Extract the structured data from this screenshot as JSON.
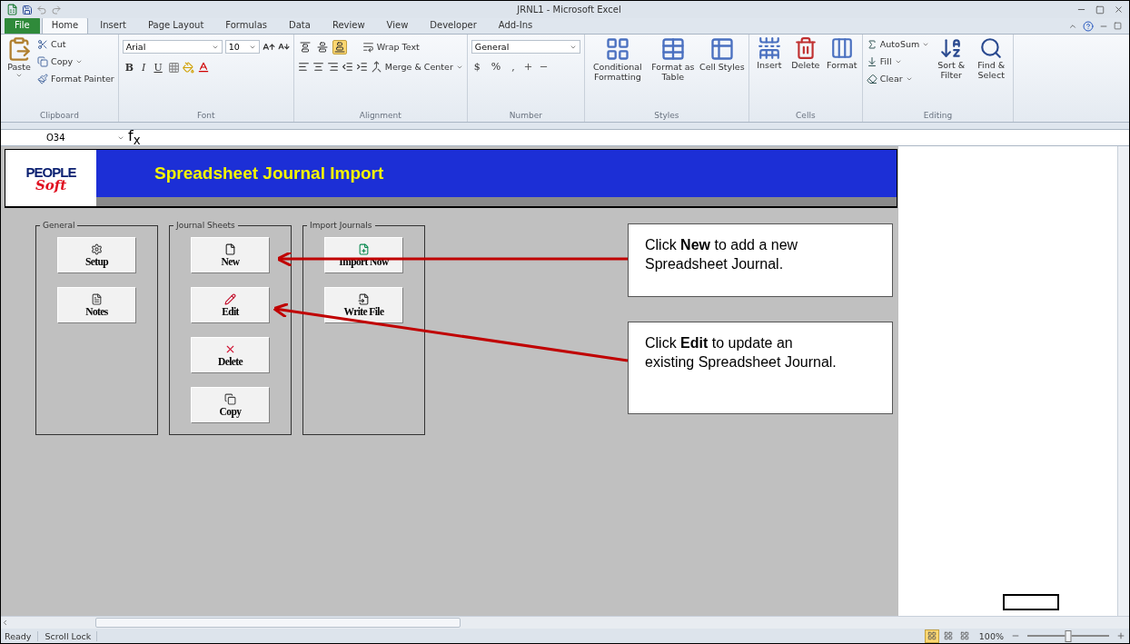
{
  "window": {
    "title": "JRNL1 - Microsoft Excel"
  },
  "tabs": [
    {
      "label": "File",
      "kind": "file",
      "selected": false
    },
    {
      "label": "Home",
      "kind": "tab",
      "selected": true
    },
    {
      "label": "Insert",
      "kind": "tab",
      "selected": false
    },
    {
      "label": "Page Layout",
      "kind": "tab",
      "selected": false
    },
    {
      "label": "Formulas",
      "kind": "tab",
      "selected": false
    },
    {
      "label": "Data",
      "kind": "tab",
      "selected": false
    },
    {
      "label": "Review",
      "kind": "tab",
      "selected": false
    },
    {
      "label": "View",
      "kind": "tab",
      "selected": false
    },
    {
      "label": "Developer",
      "kind": "tab",
      "selected": false
    },
    {
      "label": "Add-Ins",
      "kind": "tab",
      "selected": false
    }
  ],
  "ribbon": {
    "clipboard": {
      "label": "Clipboard",
      "paste": {
        "label": "Paste",
        "dropdown": true
      },
      "items": [
        {
          "label": "Cut",
          "dropdown": false
        },
        {
          "label": "Copy",
          "dropdown": true
        },
        {
          "label": "Format Painter",
          "dropdown": false
        }
      ]
    },
    "font": {
      "label": "Font",
      "font_name": "Arial",
      "font_size": "10",
      "style_buttons": [
        "B",
        "I",
        "U"
      ]
    },
    "alignment": {
      "label": "Alignment",
      "align_buttons": [
        {
          "selected": false
        },
        {
          "selected": false
        },
        {
          "selected": true
        }
      ],
      "wrap_text": "Wrap Text",
      "merge": "Merge & Center"
    },
    "number": {
      "label": "Number",
      "format": "General",
      "symbols": [
        "$",
        "%",
        ","
      ]
    },
    "styles": {
      "label": "Styles",
      "items": [
        {
          "label": "Conditional Formatting"
        },
        {
          "label": "Format as Table"
        },
        {
          "label": "Cell Styles"
        }
      ]
    },
    "cells": {
      "label": "Cells",
      "items": [
        {
          "label": "Insert"
        },
        {
          "label": "Delete"
        },
        {
          "label": "Format"
        }
      ]
    },
    "editing": {
      "label": "Editing",
      "small": [
        {
          "label": "AutoSum"
        },
        {
          "label": "Fill"
        },
        {
          "label": "Clear"
        }
      ],
      "large": [
        {
          "label": "Sort & Filter"
        },
        {
          "label": "Find & Select"
        }
      ]
    }
  },
  "formula_bar": {
    "name_box": "O34",
    "function_symbol": "f$_{x}$"
  },
  "sheet": {
    "logo": {
      "line1": "PEOPLE",
      "line2": "Soft"
    },
    "title": "Spreadsheet Journal Import",
    "groups": [
      {
        "title": "General",
        "buttons": [
          {
            "label": "Setup"
          },
          {
            "label": "Notes"
          }
        ]
      },
      {
        "title": "Journal Sheets",
        "buttons": [
          {
            "label": "New"
          },
          {
            "label": "Edit"
          },
          {
            "label": "Delete"
          },
          {
            "label": "Copy"
          }
        ]
      },
      {
        "title": "Import Journals",
        "buttons": [
          {
            "label": "Import Now"
          },
          {
            "label": "Write File"
          }
        ]
      }
    ],
    "callouts": [
      {
        "text": "Click **New** to add a new Spreadsheet Journal."
      },
      {
        "text": "Click **Edit** to update an existing Spreadsheet Journal."
      }
    ]
  },
  "status_bar": {
    "items": [
      "Ready",
      "Scroll Lock"
    ],
    "views": [
      {
        "selected": true
      },
      {
        "selected": false
      },
      {
        "selected": false
      }
    ],
    "zoom": "100%",
    "zoom_slider": {
      "level": 0.5
    }
  }
}
